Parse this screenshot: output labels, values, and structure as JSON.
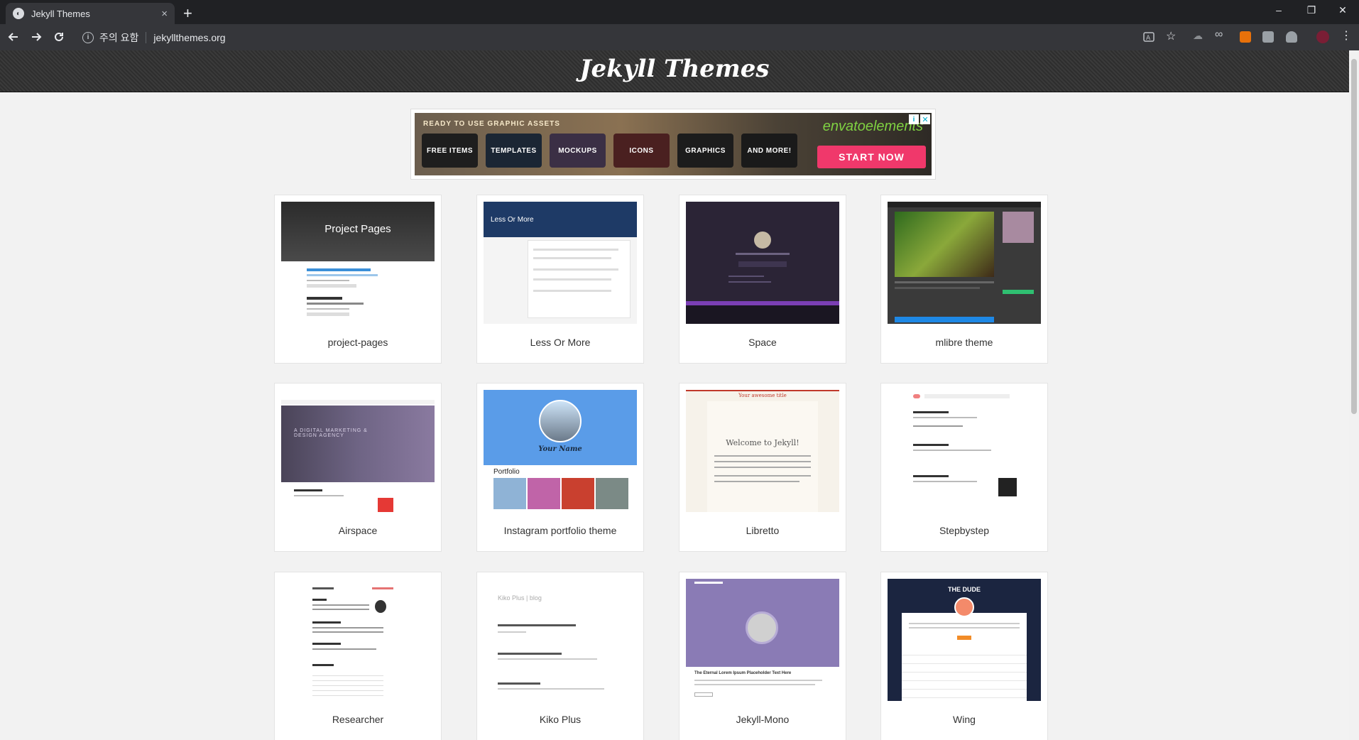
{
  "browser": {
    "tab_title": "Jekyll Themes",
    "new_tab": "+",
    "security_label": "주의 요함",
    "url": "jekyllthemes.org",
    "window": {
      "minimize": "–",
      "restore": "❐",
      "close": "✕"
    }
  },
  "site": {
    "logo": "Jekyll Themes"
  },
  "ad": {
    "headline": "READY TO USE GRAPHIC ASSETS",
    "categories": [
      "FREE ITEMS",
      "TEMPLATES",
      "MOCKUPS",
      "ICONS",
      "GRAPHICS",
      "AND MORE!"
    ],
    "brand": "envatoelements",
    "cta": "START NOW"
  },
  "themes": [
    {
      "name": "project-pages",
      "preview_title": "Project Pages"
    },
    {
      "name": "Less Or More",
      "preview_title": "Less Or More"
    },
    {
      "name": "Space"
    },
    {
      "name": "mlibre theme"
    },
    {
      "name": "Airspace",
      "preview_title": "A DIGITAL MARKETING & DESIGN AGENCY"
    },
    {
      "name": "Instagram portfolio theme",
      "preview_title": "Your Name",
      "preview_subtitle": "Portfolio"
    },
    {
      "name": "Libretto",
      "preview_title": "Welcome to Jekyll!",
      "preview_header": "Your awesome title"
    },
    {
      "name": "Stepbystep"
    },
    {
      "name": "Researcher"
    },
    {
      "name": "Kiko Plus",
      "preview_title": "Kiko Plus | blog"
    },
    {
      "name": "Jekyll-Mono",
      "preview_title": "The Eternal Lorem Ipsum Placeholder Text Here"
    },
    {
      "name": "Wing",
      "preview_title": "THE DUDE"
    }
  ],
  "colors": {
    "chrome_dark": "#202124",
    "chrome_toolbar": "#35363a",
    "page_bg": "#f2f2f2",
    "ad_cta": "#f0386b",
    "envato_green": "#7fd142"
  }
}
